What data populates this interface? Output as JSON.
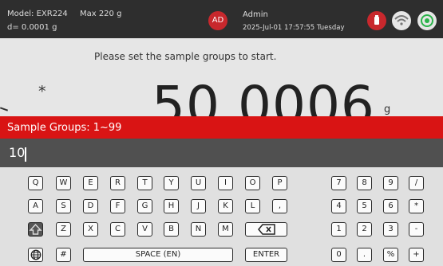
{
  "header": {
    "model": "Model: EXR224",
    "max": "Max 220 g",
    "resolution": "d= 0.0001 g",
    "avatar": "AD",
    "user": "Admin",
    "datetime": "2025-Jul-01 17:57:55 Tuesday"
  },
  "icons": {
    "usb": "usb-icon",
    "wifi": "wifi-icon",
    "target": "target-icon"
  },
  "main": {
    "prompt": "Please set the sample groups to start.",
    "asterisk": "*",
    "weight": "50.0006",
    "unit": "g"
  },
  "dialog": {
    "label": "Sample Groups: 1~99",
    "value": "10"
  },
  "keyboard": {
    "row1": [
      "Q",
      "W",
      "E",
      "R",
      "T",
      "Y",
      "U",
      "I",
      "O",
      "P"
    ],
    "row2": [
      "A",
      "S",
      "D",
      "F",
      "G",
      "H",
      "J",
      "K",
      "L",
      ","
    ],
    "row3": [
      "Z",
      "X",
      "C",
      "V",
      "B",
      "N",
      "M"
    ],
    "space": "SPACE (EN)",
    "enter": "ENTER",
    "hash": "#",
    "numpad": [
      [
        "7",
        "8",
        "9",
        "/"
      ],
      [
        "4",
        "5",
        "6",
        "*"
      ],
      [
        "1",
        "2",
        "3",
        "-"
      ],
      [
        "0",
        ".",
        "%",
        "+"
      ]
    ]
  }
}
